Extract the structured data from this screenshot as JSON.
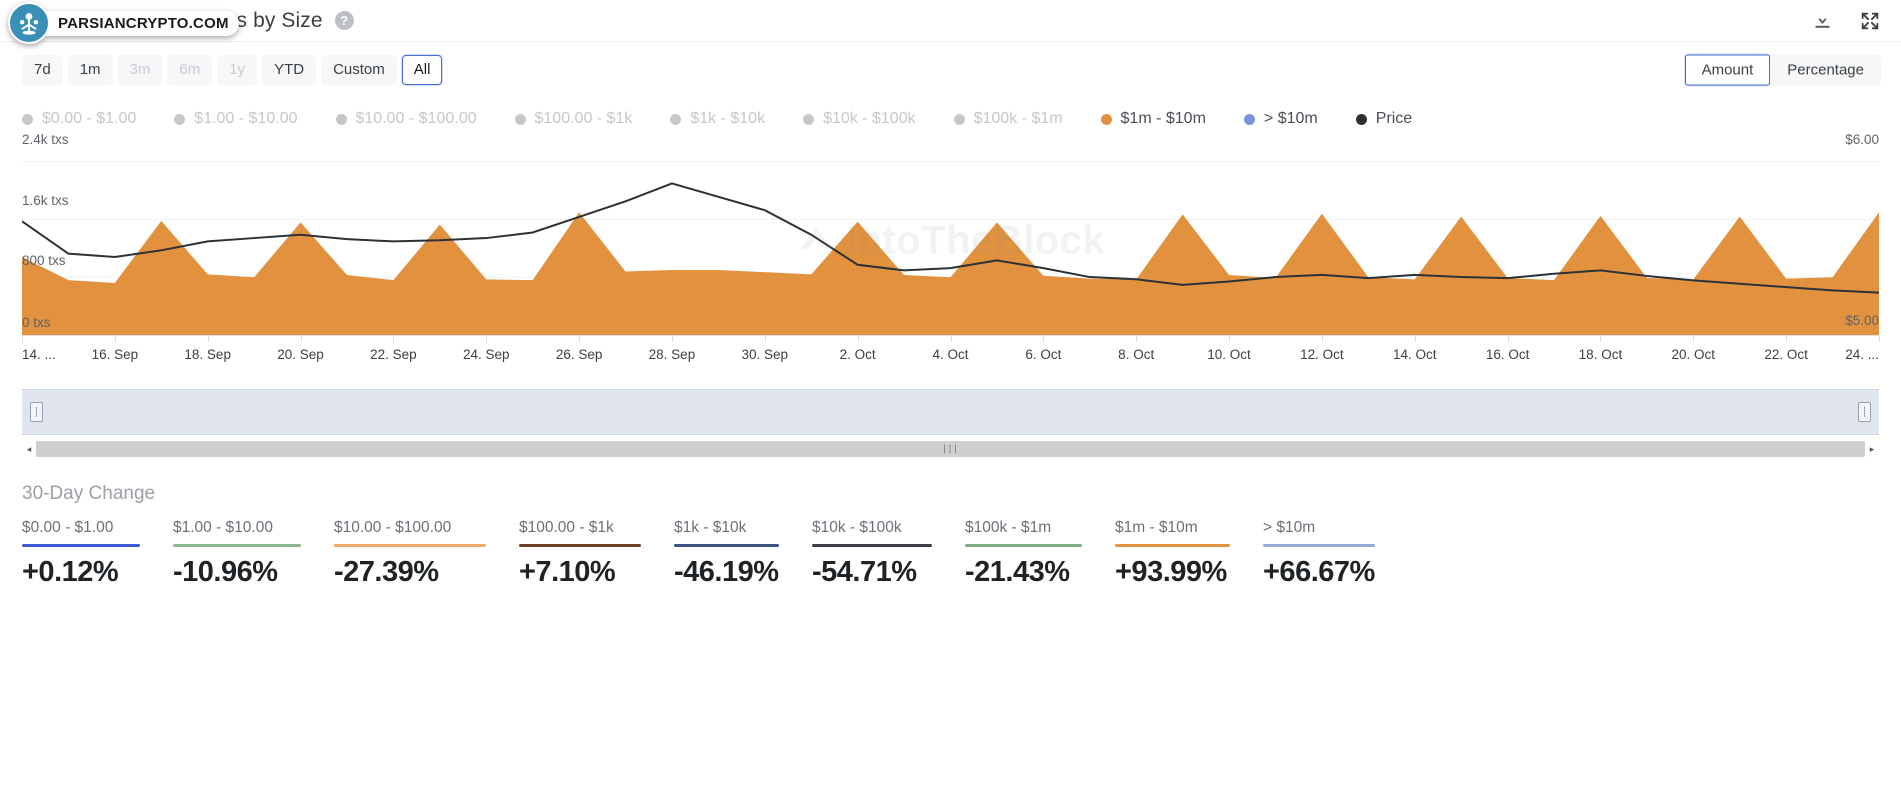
{
  "header": {
    "title": "Number of Transactions by Size",
    "help_icon": "question-mark-icon",
    "download_icon": "download-icon",
    "expand_icon": "expand-icon"
  },
  "watermark": {
    "text": "PARSIANCRYPTO.COM",
    "chart_watermark": "IntoTheBlock"
  },
  "controls": {
    "ranges": [
      {
        "label": "7d",
        "state": "enabled"
      },
      {
        "label": "1m",
        "state": "enabled"
      },
      {
        "label": "3m",
        "state": "disabled"
      },
      {
        "label": "6m",
        "state": "disabled"
      },
      {
        "label": "1y",
        "state": "disabled"
      },
      {
        "label": "YTD",
        "state": "enabled"
      },
      {
        "label": "Custom",
        "state": "enabled"
      },
      {
        "label": "All",
        "state": "active"
      }
    ],
    "units": [
      {
        "label": "Amount",
        "state": "active"
      },
      {
        "label": "Percentage",
        "state": "enabled"
      }
    ]
  },
  "legend": [
    {
      "label": "$0.00 - $1.00",
      "color": "#c4c8cc",
      "active": false
    },
    {
      "label": "$1.00 - $10.00",
      "color": "#c4c8cc",
      "active": false
    },
    {
      "label": "$10.00 - $100.00",
      "color": "#c4c8cc",
      "active": false
    },
    {
      "label": "$100.00 - $1k",
      "color": "#c4c8cc",
      "active": false
    },
    {
      "label": "$1k - $10k",
      "color": "#c4c8cc",
      "active": false
    },
    {
      "label": "$10k - $100k",
      "color": "#c4c8cc",
      "active": false
    },
    {
      "label": "$100k - $1m",
      "color": "#c4c8cc",
      "active": false
    },
    {
      "label": "$1m - $10m",
      "color": "#e2923f",
      "active": true
    },
    {
      "label": "> $10m",
      "color": "#7b93dd",
      "active": true
    },
    {
      "label": "Price",
      "color": "#2b3137",
      "active": true
    }
  ],
  "navigator": {
    "left_handle": "navigator-left-handle",
    "right_handle": "navigator-right-handle",
    "scroll_left": "◂",
    "scroll_right": "▸",
    "grip": "∣∣∣"
  },
  "change_section": {
    "title": "30-Day Change",
    "items": [
      {
        "label": "$0.00 - $1.00",
        "value": "+0.12%",
        "color": "#3b5bd4"
      },
      {
        "label": "$1.00 - $10.00",
        "value": "-10.96%",
        "color": "#8db88f"
      },
      {
        "label": "$10.00 - $100.00",
        "value": "-27.39%",
        "color": "#efab6b"
      },
      {
        "label": "$100.00 - $1k",
        "value": "+7.10%",
        "color": "#6d4224"
      },
      {
        "label": "$1k - $10k",
        "value": "-46.19%",
        "color": "#3c5280"
      },
      {
        "label": "$10k - $100k",
        "value": "-54.71%",
        "color": "#3a3f45"
      },
      {
        "label": "$100k - $1m",
        "value": "-21.43%",
        "color": "#7fae86"
      },
      {
        "label": "$1m - $10m",
        "value": "+93.99%",
        "color": "#e0943f"
      },
      {
        "label": "> $10m",
        "value": "+66.67%",
        "color": "#96acd8"
      }
    ]
  },
  "chart_data": {
    "type": "area",
    "title": "Number of Transactions by Size",
    "xlabel": "",
    "ylabel": "txs",
    "y_left_ticks": [
      "0 txs",
      "800 txs",
      "1.6k txs",
      "2.4k txs"
    ],
    "y_left_range": [
      0,
      2700
    ],
    "y_right_ticks": [
      "$5.00",
      "$6.00"
    ],
    "y_right_range": [
      4.6,
      6.35
    ],
    "grid": true,
    "legend_position": "top",
    "x_tick_labels": [
      "14. ...",
      "16. Sep",
      "18. Sep",
      "20. Sep",
      "22. Sep",
      "24. Sep",
      "26. Sep",
      "28. Sep",
      "30. Sep",
      "2. Oct",
      "4. Oct",
      "6. Oct",
      "8. Oct",
      "10. Oct",
      "12. Oct",
      "14. Oct",
      "16. Oct",
      "18. Oct",
      "20. Oct",
      "22. Oct",
      "24. ..."
    ],
    "series": [
      {
        "name": "$1m - $10m",
        "type": "area",
        "color": "#e2923f",
        "axis": "left",
        "x": [
          "14. Sep",
          "15. Sep",
          "16. Sep",
          "17. Sep",
          "18. Sep",
          "19. Sep",
          "20. Sep",
          "21. Sep",
          "22. Sep",
          "23. Sep",
          "24. Sep",
          "25. Sep",
          "26. Sep",
          "27. Sep",
          "28. Sep",
          "29. Sep",
          "30. Sep",
          "1. Oct",
          "2. Oct",
          "3. Oct",
          "4. Oct",
          "5. Oct",
          "6. Oct",
          "7. Oct",
          "8. Oct",
          "9. Oct",
          "10. Oct",
          "11. Oct",
          "12. Oct",
          "13. Oct",
          "14. Oct",
          "15. Oct",
          "16. Oct",
          "17. Oct",
          "18. Oct",
          "19. Oct",
          "20. Oct",
          "21. Oct",
          "22. Oct",
          "23. Oct",
          "24. Oct"
        ],
        "values": [
          1080,
          760,
          720,
          1580,
          840,
          800,
          1560,
          830,
          760,
          1530,
          770,
          760,
          1700,
          880,
          900,
          900,
          870,
          840,
          1570,
          830,
          800,
          1560,
          820,
          780,
          770,
          1670,
          830,
          790,
          1680,
          800,
          770,
          1640,
          790,
          760,
          1650,
          790,
          770,
          1640,
          780,
          800,
          1700
        ]
      },
      {
        "name": "> $10m",
        "type": "area",
        "color": "#9db0e0",
        "axis": "left",
        "values": [
          18,
          14,
          12,
          18,
          14,
          13,
          18,
          14,
          12,
          17,
          13,
          12,
          19,
          15,
          15,
          15,
          14,
          14,
          18,
          14,
          13,
          18,
          13,
          12,
          12,
          19,
          14,
          13,
          19,
          13,
          12,
          18,
          13,
          12,
          18,
          13,
          12,
          18,
          13,
          13,
          19
        ]
      },
      {
        "name": "Price",
        "type": "line",
        "color": "#2b3137",
        "axis": "right",
        "values": [
          5.62,
          5.33,
          5.3,
          5.36,
          5.44,
          5.47,
          5.5,
          5.46,
          5.44,
          5.45,
          5.47,
          5.52,
          5.66,
          5.8,
          5.96,
          5.84,
          5.72,
          5.5,
          5.23,
          5.18,
          5.2,
          5.27,
          5.2,
          5.12,
          5.1,
          5.05,
          5.08,
          5.12,
          5.14,
          5.11,
          5.14,
          5.12,
          5.11,
          5.15,
          5.18,
          5.13,
          5.09,
          5.06,
          5.03,
          5.0,
          4.98
        ]
      }
    ]
  }
}
